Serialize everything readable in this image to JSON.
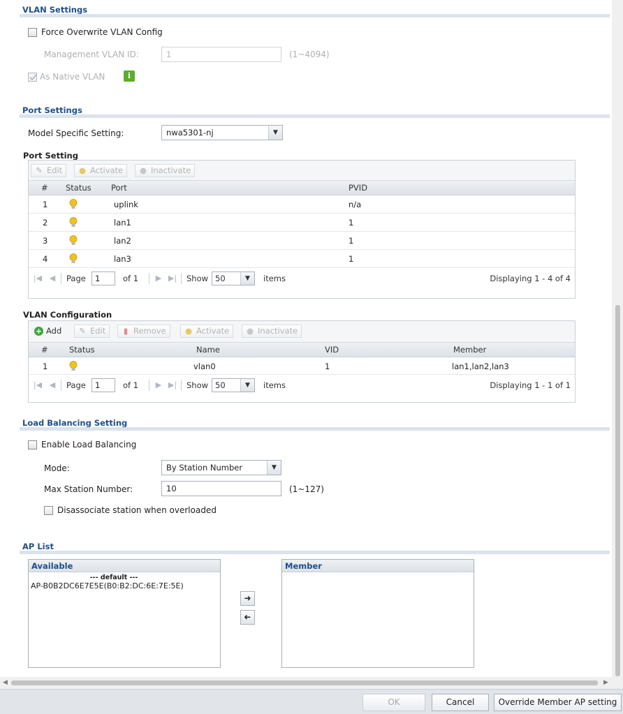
{
  "vlan_settings": {
    "title": "VLAN Settings",
    "force_overwrite_label": "Force Overwrite VLAN Config",
    "mgmt_vlan_label": "Management VLAN ID:",
    "mgmt_vlan_value": "1",
    "mgmt_vlan_range": "(1~4094)",
    "native_vlan_label": "As Native VLAN",
    "native_vlan_checked": true
  },
  "port_settings": {
    "title": "Port Settings",
    "model_label": "Model Specific Setting:",
    "model_value": "nwa5301-nj",
    "subtitle": "Port Setting",
    "toolbar": {
      "edit": "Edit",
      "activate": "Activate",
      "inactivate": "Inactivate"
    },
    "columns": {
      "num": "#",
      "status": "Status",
      "port": "Port",
      "pvid": "PVID"
    },
    "rows": [
      {
        "num": "1",
        "port": "uplink",
        "pvid": "n/a"
      },
      {
        "num": "2",
        "port": "lan1",
        "pvid": "1"
      },
      {
        "num": "3",
        "port": "lan2",
        "pvid": "1"
      },
      {
        "num": "4",
        "port": "lan3",
        "pvid": "1"
      }
    ],
    "pager": {
      "page_label": "Page",
      "page": "1",
      "of": "of 1",
      "show": "Show",
      "per_page": "50",
      "items": "items",
      "displaying": "Displaying 1 - 4 of 4"
    }
  },
  "vlan_config": {
    "title": "VLAN Configuration",
    "toolbar": {
      "add": "Add",
      "edit": "Edit",
      "remove": "Remove",
      "activate": "Activate",
      "inactivate": "Inactivate"
    },
    "columns": {
      "num": "#",
      "status": "Status",
      "name": "Name",
      "vid": "VID",
      "member": "Member"
    },
    "rows": [
      {
        "num": "1",
        "name": "vlan0",
        "vid": "1",
        "member": "lan1,lan2,lan3"
      }
    ],
    "pager": {
      "page_label": "Page",
      "page": "1",
      "of": "of 1",
      "show": "Show",
      "per_page": "50",
      "items": "items",
      "displaying": "Displaying 1 - 1 of 1"
    }
  },
  "load_balancing": {
    "title": "Load Balancing Setting",
    "enable_label": "Enable Load Balancing",
    "mode_label": "Mode:",
    "mode_value": "By Station Number",
    "max_station_label": "Max Station Number:",
    "max_station_value": "10",
    "max_station_range": "(1~127)",
    "disassociate_label": "Disassociate station when overloaded"
  },
  "ap_list": {
    "title": "AP List",
    "available_header": "Available",
    "group_label": "--- default ---",
    "available_items": [
      "AP-B0B2DC6E7E5E(B0:B2:DC:6E:7E:5E)"
    ],
    "member_header": "Member",
    "move_right_icon": "arrow-right-icon",
    "move_left_icon": "arrow-left-icon"
  },
  "footer": {
    "ok": "OK",
    "cancel": "Cancel",
    "override": "Override Member AP setting"
  },
  "colors": {
    "section_title": "#1e4f8a",
    "section_line": "#dbe3ec",
    "bulb": "#f2c21c",
    "add_green": "#3fa53f",
    "remove_red": "#d9534f",
    "info_green": "#5cad2c"
  }
}
